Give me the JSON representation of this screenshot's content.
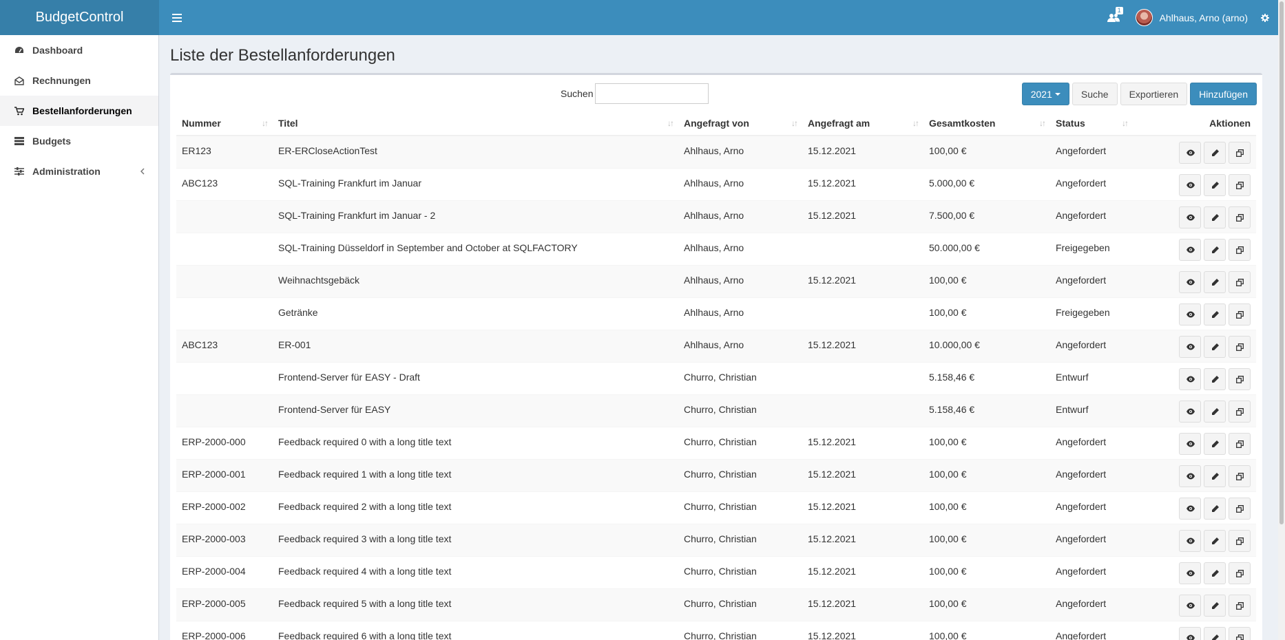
{
  "app": {
    "title": "BudgetControl"
  },
  "header": {
    "user_name": "Ahlhaus, Arno (arno)",
    "users_badge": "1"
  },
  "sidebar": {
    "items": [
      {
        "label": "Dashboard",
        "icon": "dashboard-icon"
      },
      {
        "label": "Rechnungen",
        "icon": "envelope-open-icon"
      },
      {
        "label": "Bestellanforderungen",
        "icon": "cart-icon",
        "active": true
      },
      {
        "label": "Budgets",
        "icon": "list-icon"
      },
      {
        "label": "Administration",
        "icon": "sliders-icon"
      }
    ]
  },
  "main": {
    "page_title": "Liste der Bestellanforderungen",
    "search_label": "Suchen",
    "search_value": "",
    "year_button": "2021",
    "search_button": "Suche",
    "export_button": "Exportieren",
    "add_button": "Hinzufügen",
    "columns": [
      "Nummer",
      "Titel",
      "Angefragt von",
      "Angefragt am",
      "Gesamtkosten",
      "Status",
      "Aktionen"
    ],
    "rows": [
      [
        "ER123",
        "ER-ERCloseActionTest",
        "Ahlhaus, Arno",
        "15.12.2021",
        "100,00 €",
        "Angefordert"
      ],
      [
        "ABC123",
        "SQL-Training Frankfurt im Januar",
        "Ahlhaus, Arno",
        "15.12.2021",
        "5.000,00 €",
        "Angefordert"
      ],
      [
        "",
        "SQL-Training Frankfurt im Januar - 2",
        "Ahlhaus, Arno",
        "15.12.2021",
        "7.500,00 €",
        "Angefordert"
      ],
      [
        "",
        "SQL-Training Düsseldorf in September and October at SQLFACTORY",
        "Ahlhaus, Arno",
        "",
        "50.000,00 €",
        "Freigegeben"
      ],
      [
        "",
        "Weihnachtsgebäck",
        "Ahlhaus, Arno",
        "15.12.2021",
        "100,00 €",
        "Angefordert"
      ],
      [
        "",
        "Getränke",
        "Ahlhaus, Arno",
        "",
        "100,00 €",
        "Freigegeben"
      ],
      [
        "ABC123",
        "ER-001",
        "Ahlhaus, Arno",
        "15.12.2021",
        "10.000,00 €",
        "Angefordert"
      ],
      [
        "",
        "Frontend-Server für EASY - Draft",
        "Churro, Christian",
        "",
        "5.158,46 €",
        "Entwurf"
      ],
      [
        "",
        "Frontend-Server für EASY",
        "Churro, Christian",
        "",
        "5.158,46 €",
        "Entwurf"
      ],
      [
        "ERP-2000-000",
        "Feedback required 0 with a long title text",
        "Churro, Christian",
        "15.12.2021",
        "100,00 €",
        "Angefordert"
      ],
      [
        "ERP-2000-001",
        "Feedback required 1 with a long title text",
        "Churro, Christian",
        "15.12.2021",
        "100,00 €",
        "Angefordert"
      ],
      [
        "ERP-2000-002",
        "Feedback required 2 with a long title text",
        "Churro, Christian",
        "15.12.2021",
        "100,00 €",
        "Angefordert"
      ],
      [
        "ERP-2000-003",
        "Feedback required 3 with a long title text",
        "Churro, Christian",
        "15.12.2021",
        "100,00 €",
        "Angefordert"
      ],
      [
        "ERP-2000-004",
        "Feedback required 4 with a long title text",
        "Churro, Christian",
        "15.12.2021",
        "100,00 €",
        "Angefordert"
      ],
      [
        "ERP-2000-005",
        "Feedback required 5 with a long title text",
        "Churro, Christian",
        "15.12.2021",
        "100,00 €",
        "Angefordert"
      ],
      [
        "ERP-2000-006",
        "Feedback required 6 with a long title text",
        "Churro, Christian",
        "15.12.2021",
        "100,00 €",
        "Angefordert"
      ]
    ]
  },
  "colors": {
    "primary": "#3c8dbc",
    "primary_dark": "#367fa9",
    "body_bg": "#ecf0f5"
  }
}
